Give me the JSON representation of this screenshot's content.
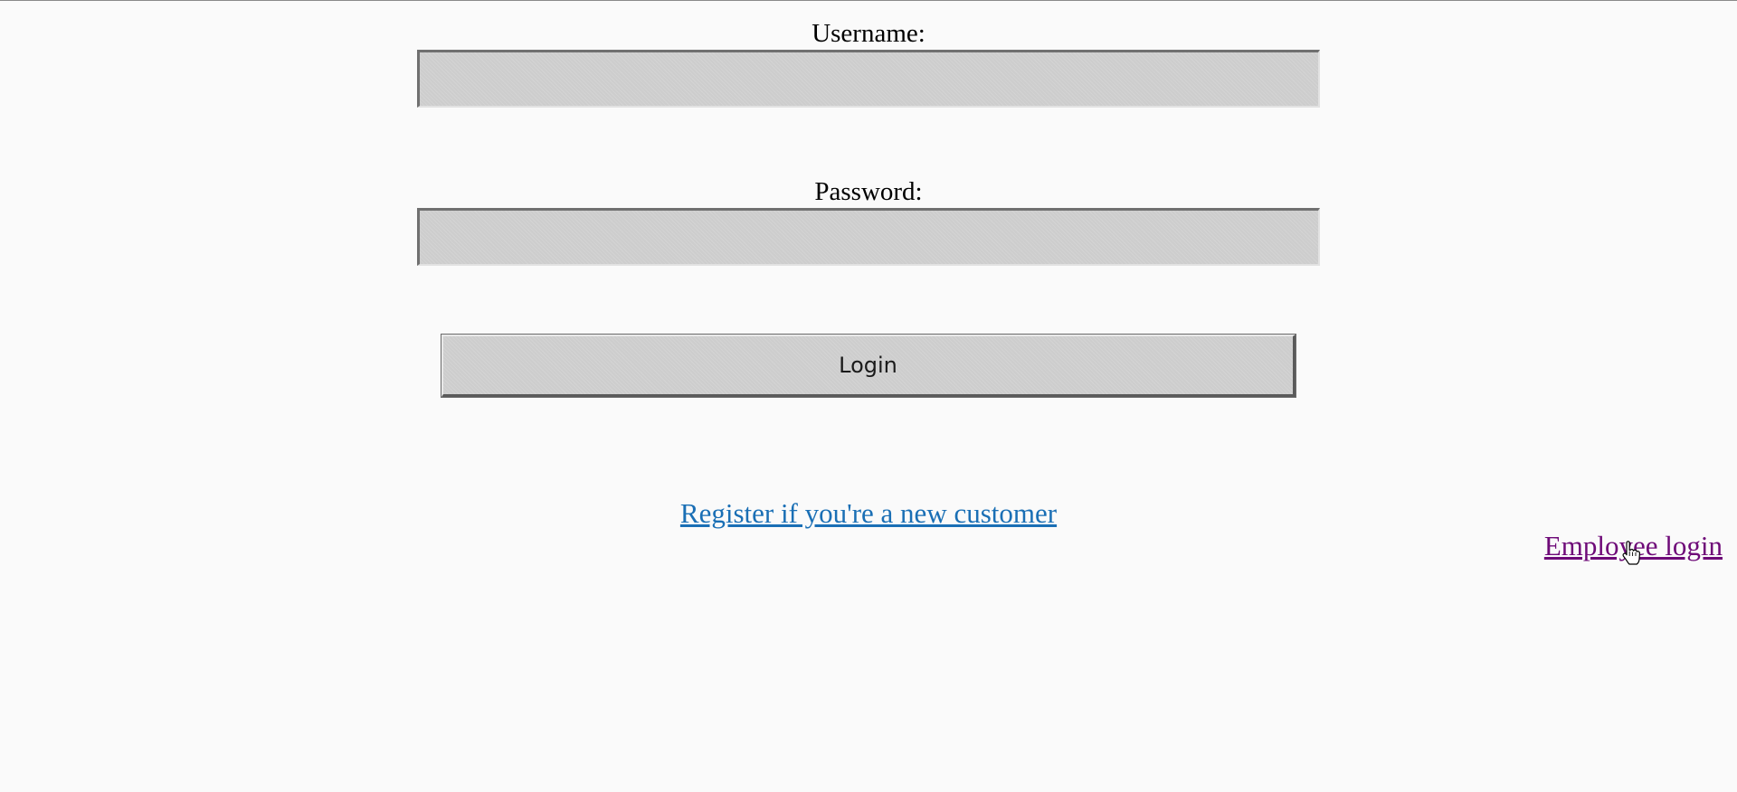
{
  "form": {
    "username": {
      "label": "Username:",
      "value": "",
      "placeholder": ""
    },
    "password": {
      "label": "Password:",
      "value": "",
      "placeholder": ""
    },
    "login_button_label": "Login"
  },
  "links": {
    "register": "Register if you're a new customer",
    "employee_login": "Employee login"
  },
  "colors": {
    "background": "#fafafa",
    "input_fill": "#cdcdcd",
    "link": "#1a6fb5",
    "visited_link": "#6e0a78"
  },
  "icons": {
    "cursor": "hand-pointer-icon"
  }
}
